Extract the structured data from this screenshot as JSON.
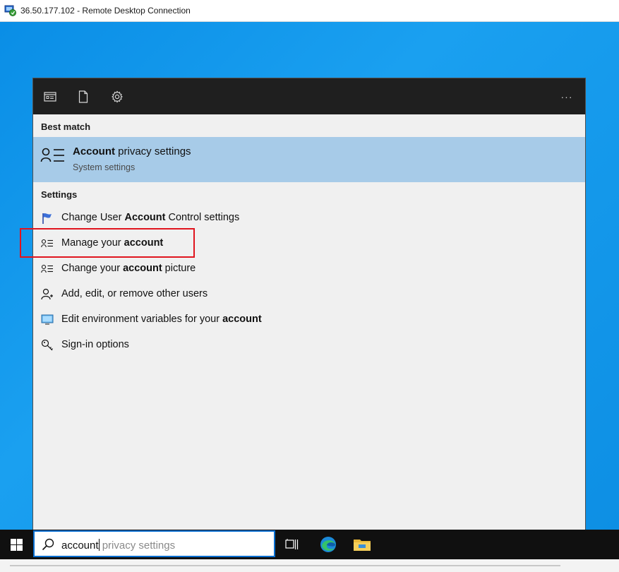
{
  "window": {
    "title": "36.50.177.102 - Remote Desktop Connection"
  },
  "panel": {
    "topbar": {
      "icons": [
        "apps-icon",
        "document-icon",
        "gear-icon"
      ],
      "more_label": "···"
    },
    "best_match": {
      "header": "Best match",
      "title_bold": "Account",
      "title_rest": " privacy settings",
      "subtitle": "System settings",
      "icon": "account-list-icon"
    },
    "settings": {
      "header": "Settings",
      "items": [
        {
          "pre": "Change User ",
          "bold": "Account",
          "post": " Control settings",
          "icon": "uac-flag-icon"
        },
        {
          "pre": "Manage your ",
          "bold": "account",
          "post": "",
          "icon": "account-list-icon"
        },
        {
          "pre": "Change your ",
          "bold": "account",
          "post": " picture",
          "icon": "account-list-icon"
        },
        {
          "pre": "Add, edit, or remove other users",
          "bold": "",
          "post": "",
          "icon": "person-add-icon"
        },
        {
          "pre": "Edit environment variables for your ",
          "bold": "account",
          "post": "",
          "icon": "monitor-icon"
        },
        {
          "pre": "Sign-in options",
          "bold": "",
          "post": "",
          "icon": "key-icon"
        }
      ]
    }
  },
  "taskbar": {
    "search": {
      "typed": "account",
      "suggestion": " privacy settings"
    },
    "apps": [
      "task-view-icon",
      "edge-icon",
      "file-explorer-icon"
    ]
  },
  "colors": {
    "desktop": "#1096e6",
    "panel_bg": "#f0f0f0",
    "topbar_bg": "#1f1f1f",
    "selected_bg": "#a7cbe8",
    "highlight_border": "#e0141e",
    "taskbar_bg": "#101010"
  }
}
